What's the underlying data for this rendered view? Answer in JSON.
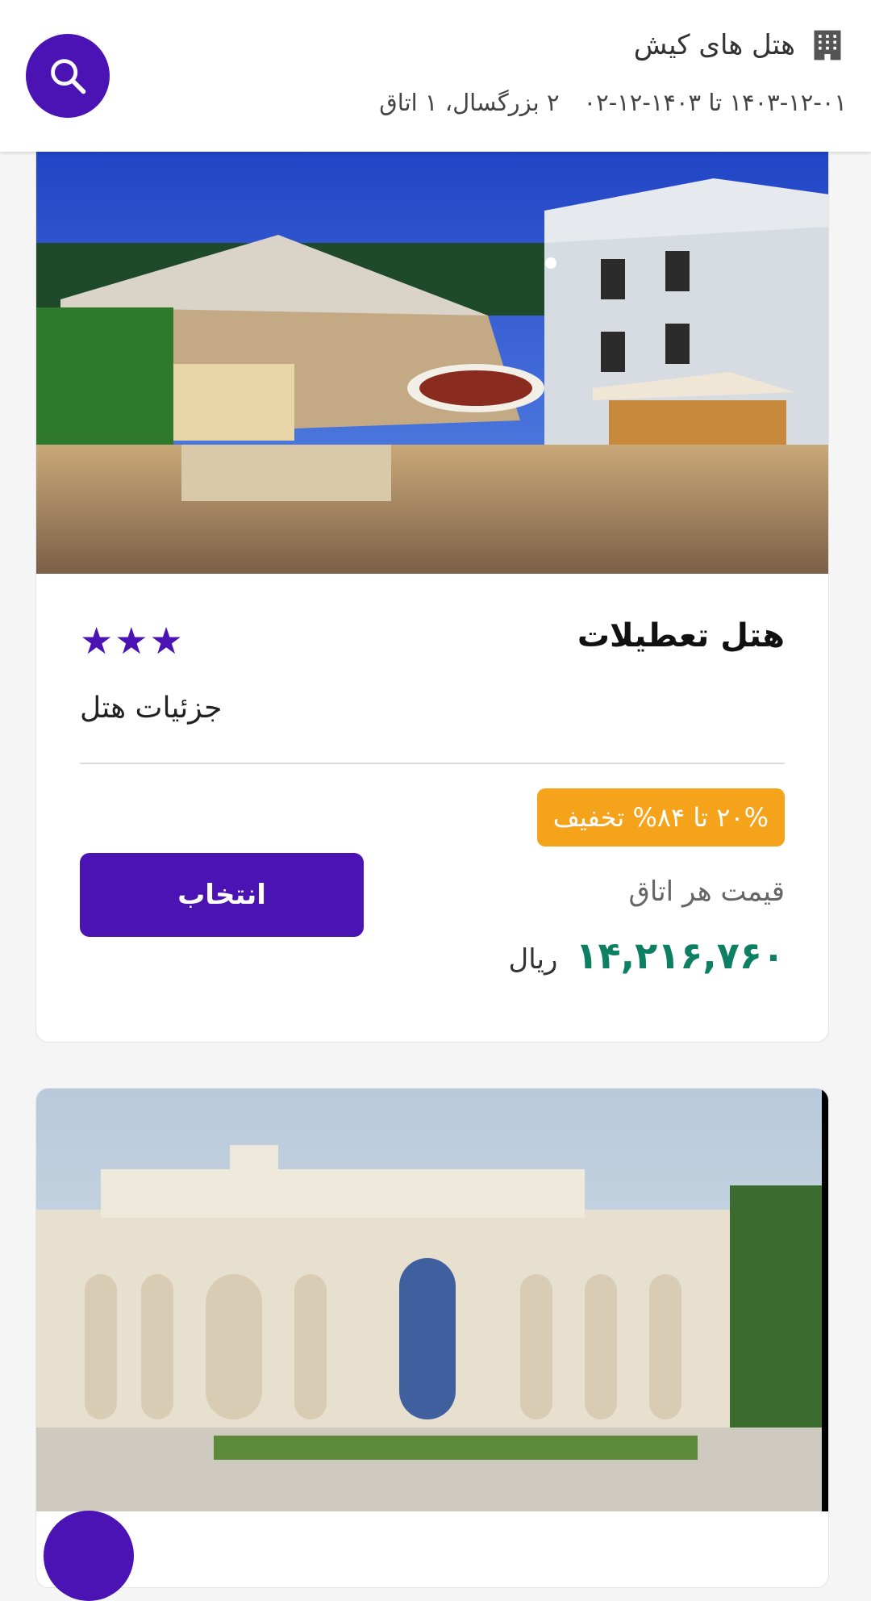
{
  "header": {
    "title": "هتل های کیش",
    "dates": "۱۴۰۳-۱۲-۰۱ تا ۱۴۰۳-۱۲-۰۲",
    "guests": "۲ بزرگسال، ۱ اتاق",
    "icons": {
      "title": "building-icon",
      "search": "search-icon"
    }
  },
  "hotels": [
    {
      "name": "هتل تعطیلات",
      "stars": "★★★",
      "details_label": "جزئیات هتل",
      "discount": "۲۰% تا ۸۴% تخفیف",
      "price_label": "قیمت هر اتاق",
      "price": "۱۴,۲۱۶,۷۶۰",
      "currency": "ریال",
      "select_label": "انتخاب"
    }
  ],
  "colors": {
    "primary": "#4b12b4",
    "discount_badge": "#f5a31a",
    "price": "#0d7f63"
  }
}
